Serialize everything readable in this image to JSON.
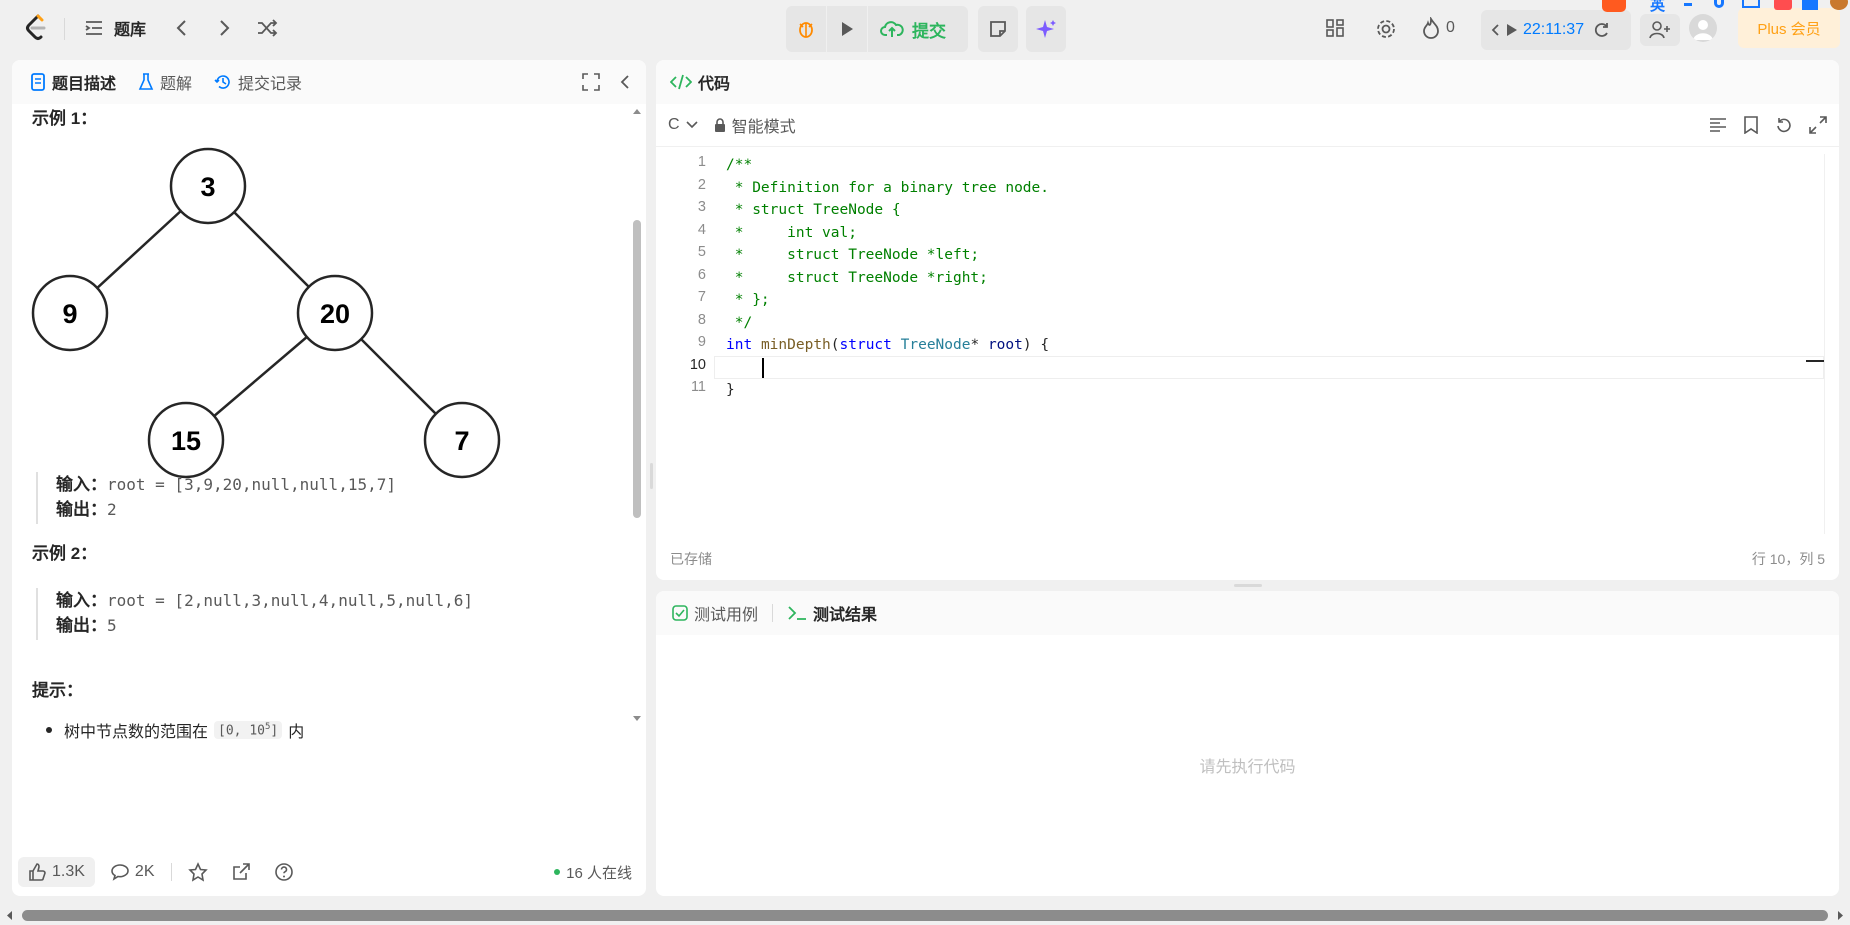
{
  "topbar": {
    "problem_bank": "题库",
    "submit": "提交",
    "streak": "0",
    "timer": "22:11:37",
    "plus": "Plus 会员",
    "ime": "英"
  },
  "left": {
    "tabs": [
      "题目描述",
      "题解",
      "提交记录"
    ],
    "example1_title": "示例 1：",
    "tree_nodes": [
      "3",
      "9",
      "20",
      "15",
      "7"
    ],
    "ex1_input_label": "输入：",
    "ex1_input_value": "root = [3,9,20,null,null,15,7]",
    "ex1_output_label": "输出：",
    "ex1_output_value": "2",
    "example2_title": "示例 2：",
    "ex2_input_label": "输入：",
    "ex2_input_value": "root = [2,null,3,null,4,null,5,null,6]",
    "ex2_output_label": "输出：",
    "ex2_output_value": "5",
    "hint_title": "提示：",
    "hint1_prefix": "树中节点数的范围在",
    "hint1_code_a": "[0, 10",
    "hint1_sup": "5",
    "hint1_code_b": "]",
    "hint1_suffix": "内",
    "likes": "1.3K",
    "comments": "2K",
    "online": "16 人在线"
  },
  "editor": {
    "title": "代码",
    "language": "C",
    "mode": "智能模式",
    "line_numbers": [
      "1",
      "2",
      "3",
      "4",
      "5",
      "6",
      "7",
      "8",
      "9",
      "10",
      "11"
    ],
    "lines": [
      "/**",
      " * Definition for a binary tree node.",
      " * struct TreeNode {",
      " *     int val;",
      " *     struct TreeNode *left;",
      " *     struct TreeNode *right;",
      " * };",
      " */",
      "",
      "    ",
      "}"
    ],
    "line9": {
      "kw1": "int",
      "fn": "minDepth",
      "p1": "(",
      "kw2": "struct",
      "ty": "TreeNode",
      "p2": "* ",
      "pm": "root",
      "p3": ") {"
    },
    "saved": "已存储",
    "cursor_pos": "行 10，列 5"
  },
  "results": {
    "tab_cases": "测试用例",
    "tab_results": "测试结果",
    "empty": "请先执行代码"
  },
  "colors": {
    "accent": "#2db55d",
    "brand_orange": "#ffa116",
    "link_blue": "#007bff",
    "purple": "#7c5cff"
  }
}
